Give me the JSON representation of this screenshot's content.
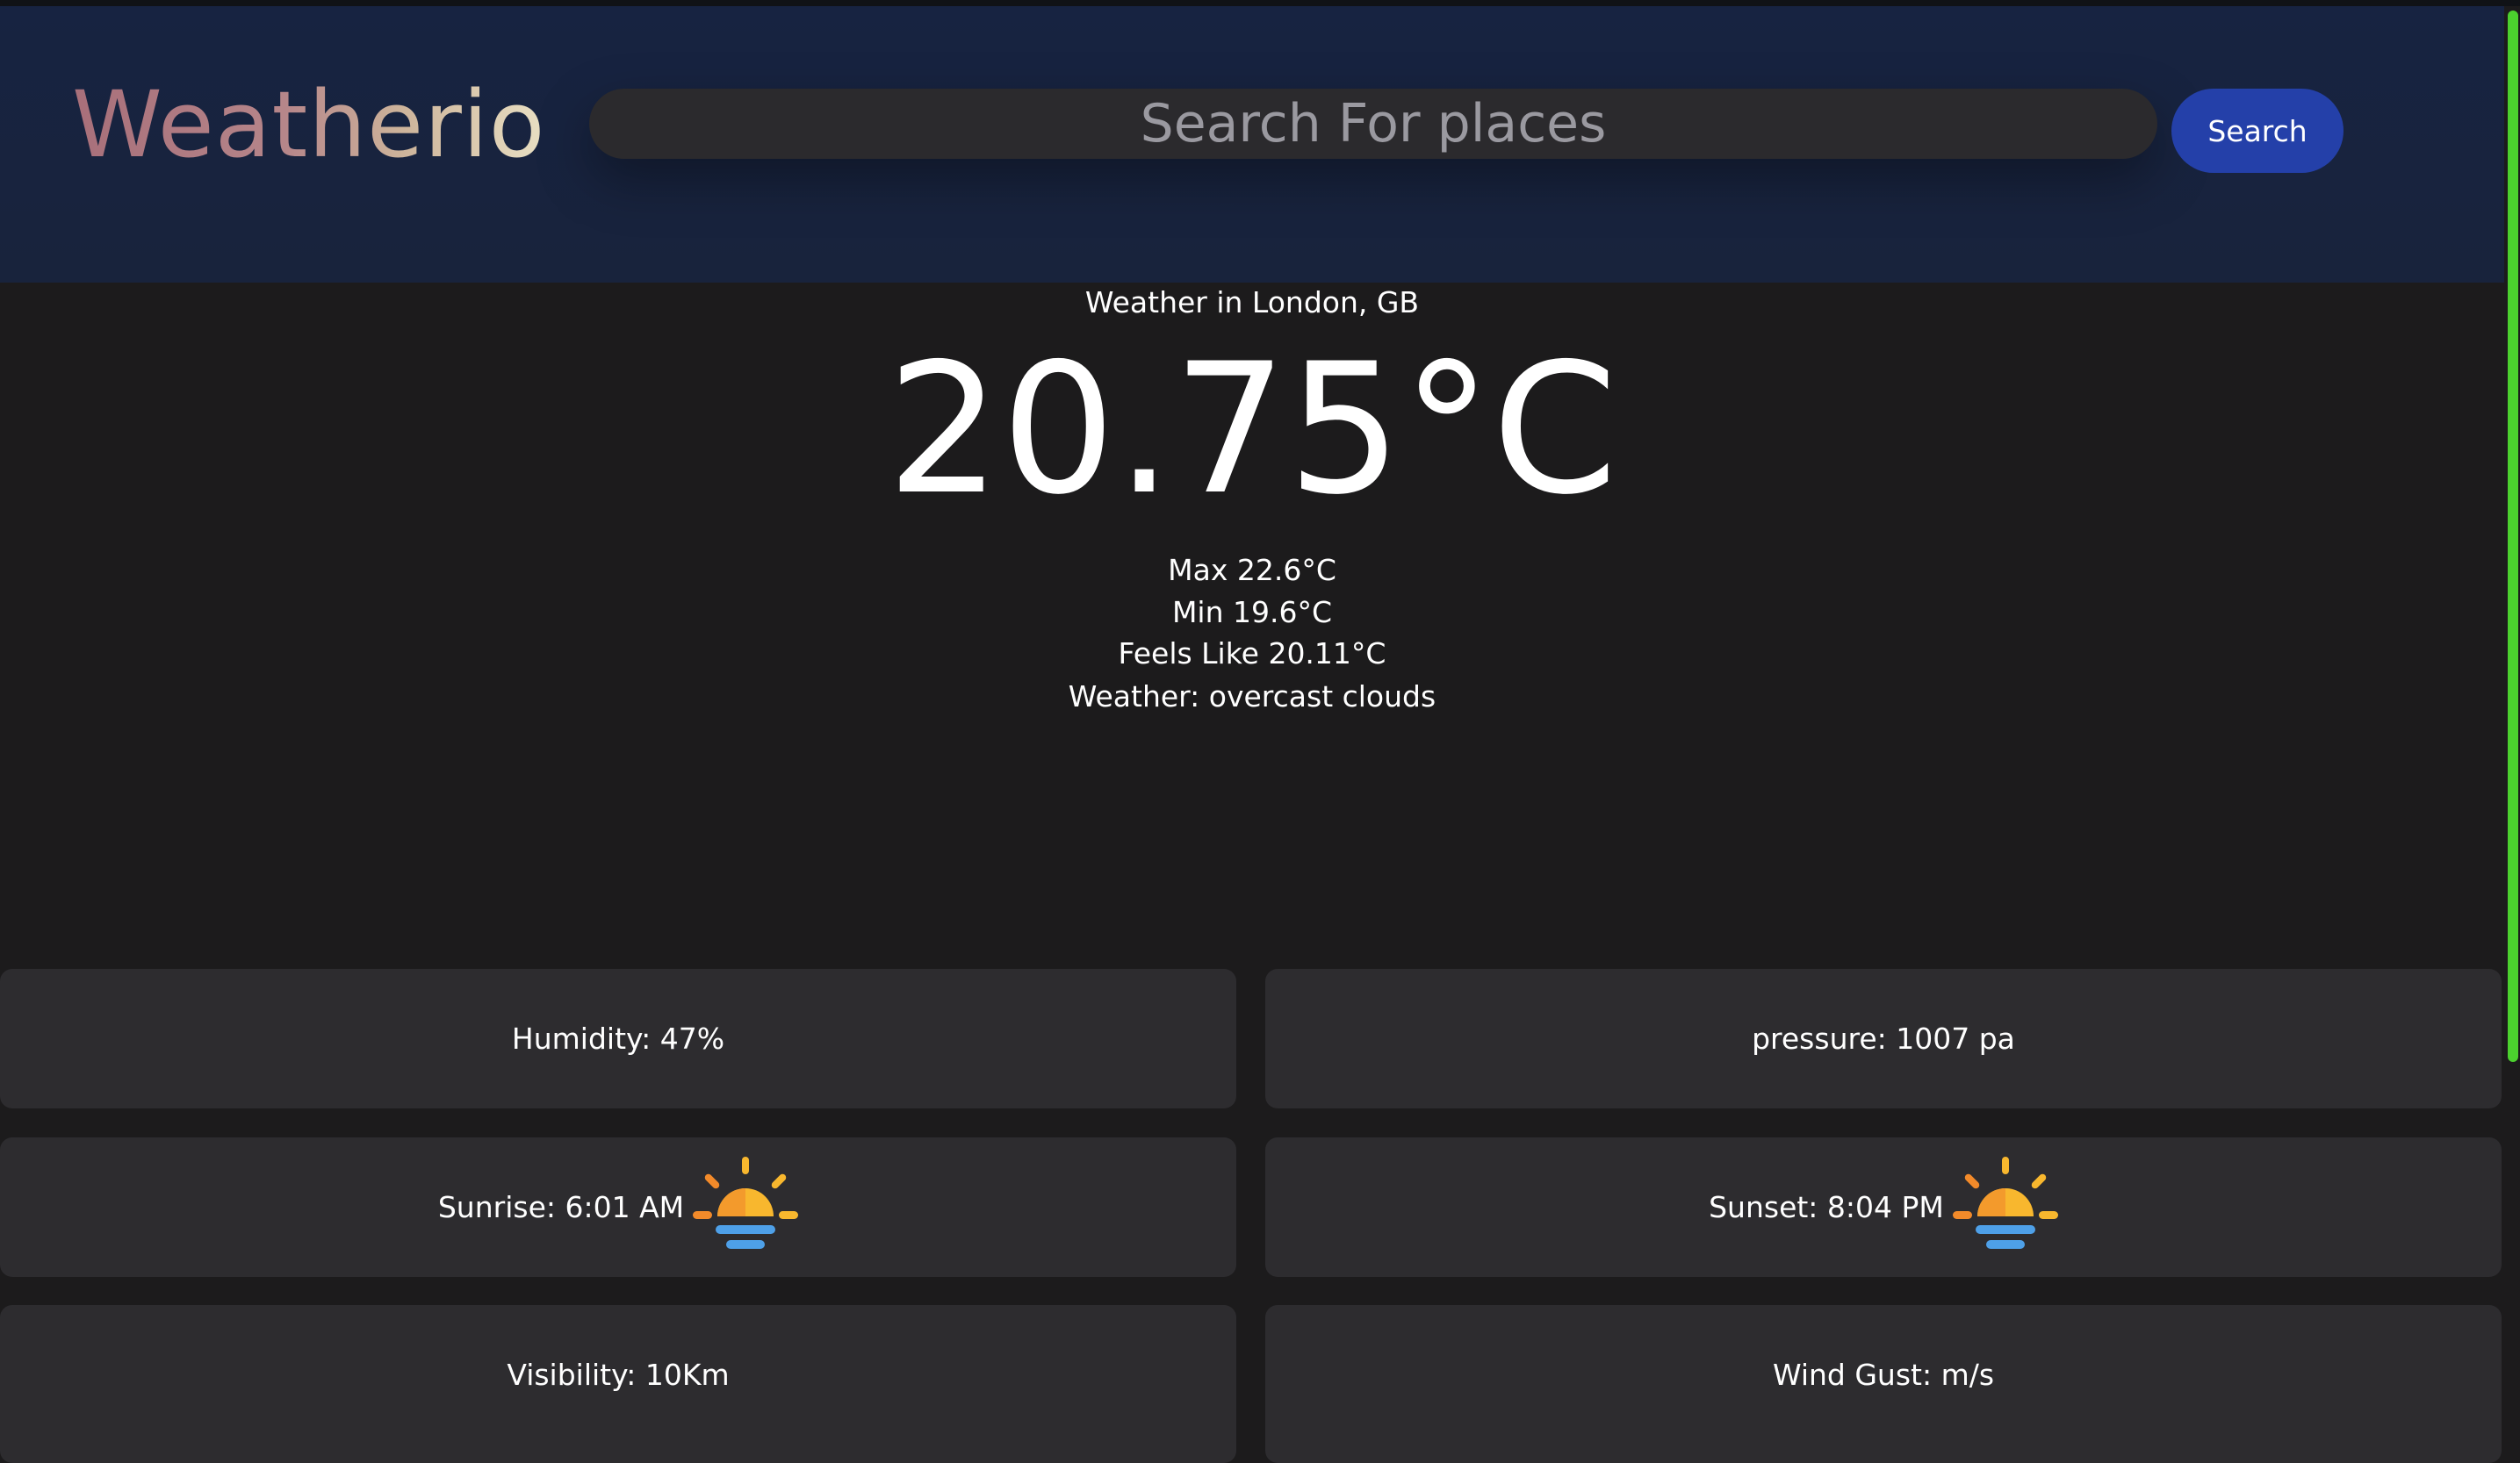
{
  "app": {
    "logo": "Weatherio"
  },
  "search": {
    "placeholder": "Search For places",
    "button_label": "Search"
  },
  "weather": {
    "location": "Weather in London, GB",
    "temperature": "20.75°C",
    "max": "Max 22.6°C",
    "min": "Min 19.6°C",
    "feels_like": "Feels Like 20.11°C",
    "description": "Weather: overcast clouds"
  },
  "details": {
    "humidity": "Humidity: 47%",
    "pressure": "pressure: 1007 pa",
    "sunrise": "Sunrise: 6:01 AM",
    "sunset": "Sunset: 8:04 PM",
    "visibility": "Visibility: 10Km",
    "wind_gust": "Wind Gust: m/s"
  },
  "icons": {
    "sunrise": "sunrise-icon",
    "sunset": "sunset-icon"
  },
  "colors": {
    "header_bg": "#172341",
    "page_bg": "#1c1b1c",
    "card_bg": "#2d2c2f",
    "search_bg": "#2b2a2d",
    "button_bg": "#2440a9",
    "scrollbar": "#4bd12e",
    "sun_yellow": "#f8b72e",
    "sun_orange": "#f28a2a",
    "horizon_blue": "#4ea0e8"
  }
}
